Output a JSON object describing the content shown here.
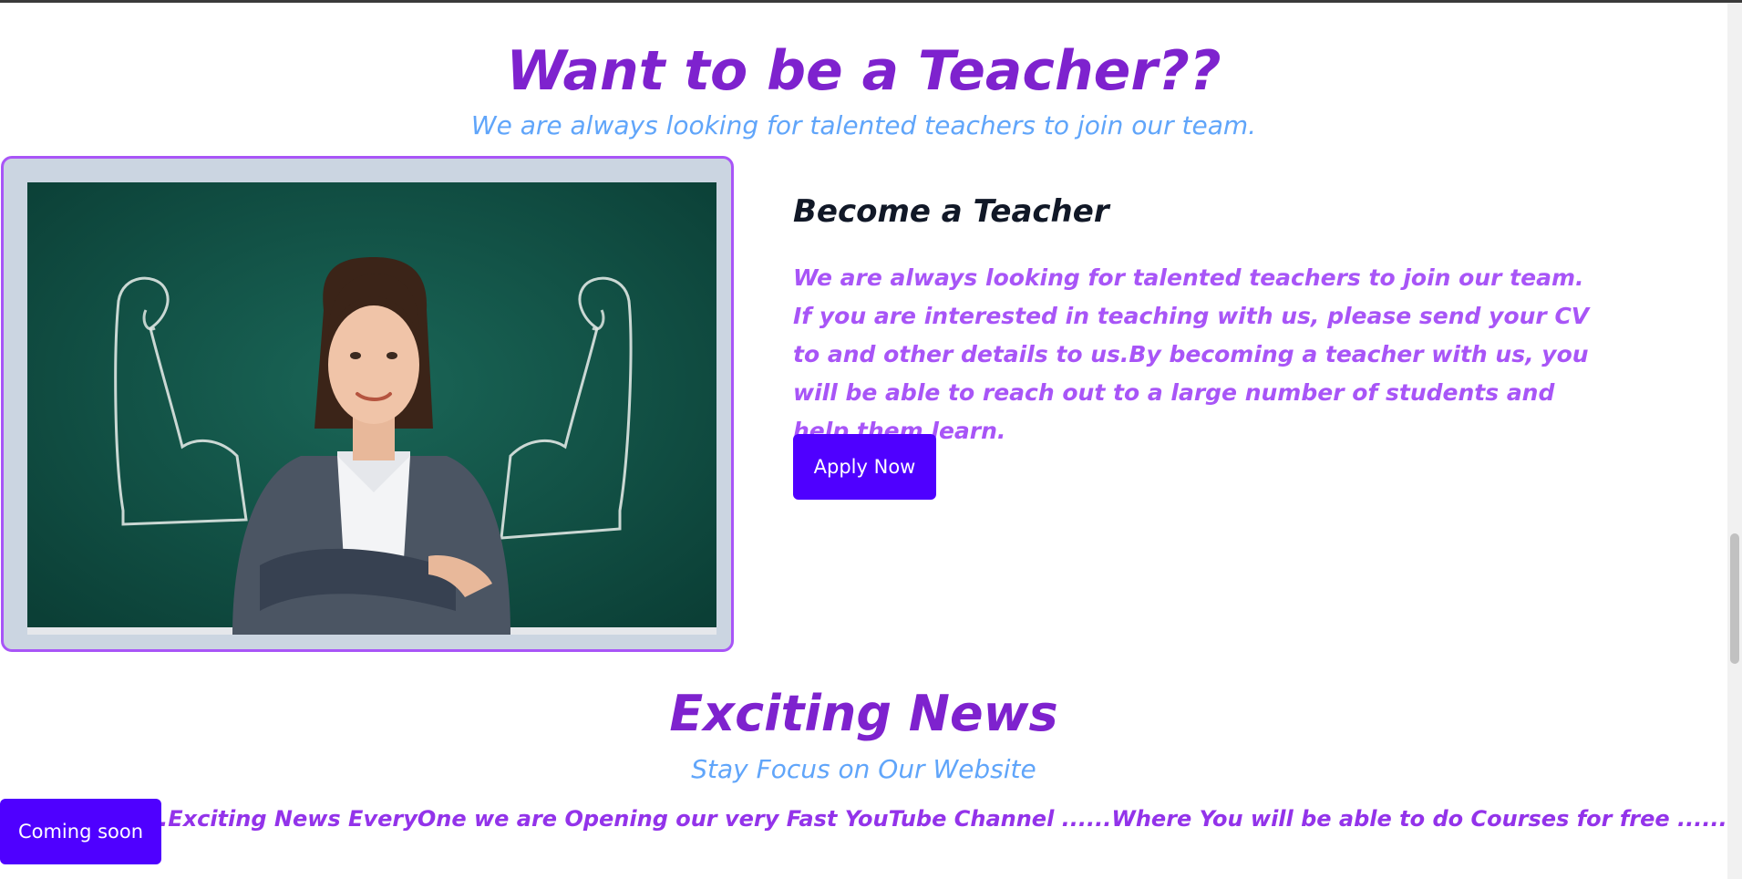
{
  "teacher_section": {
    "title": "Want to be a Teacher??",
    "subtitle": "We are always looking for talented teachers to join our team.",
    "card_title": "Become a Teacher",
    "card_text": "We are always looking for talented teachers to join our team. If you are interested in teaching with us, please send your CV to and other details to us.By becoming a teacher with us, you will be able to reach out to a large number of students and help them learn.",
    "apply_label": "Apply Now",
    "image_icon": "teacher-photo"
  },
  "news_section": {
    "title": "Exciting News",
    "subtitle": "Stay Focus on Our Website",
    "marquee_text": "dates.......Exciting News EveryOne we are Opening our very Fast YouTube Channel ......Where You will be able to do Courses for free ......Stay Focus on Our Websit",
    "coming_soon_label": "Coming soon"
  },
  "colors": {
    "accent_purple": "#7e22ce",
    "text_purple": "#a855f7",
    "subtitle_blue": "#60a5fa",
    "button_blue": "#4f00ff",
    "frame_gray": "#cbd5e1"
  }
}
